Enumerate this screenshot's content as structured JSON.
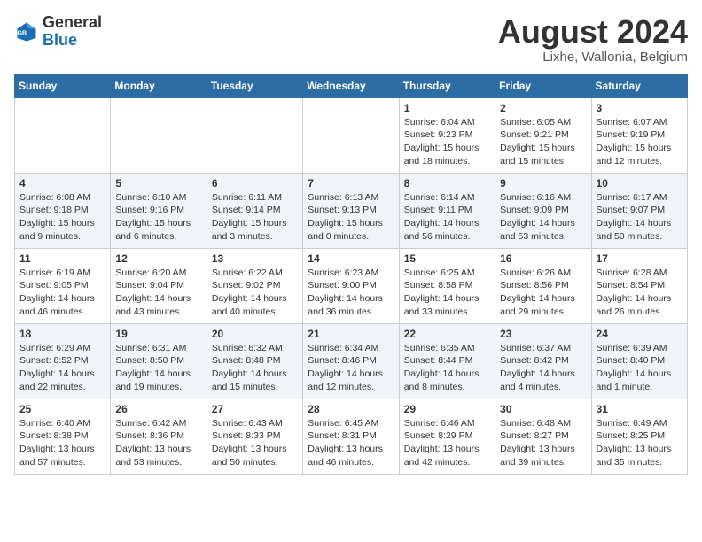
{
  "header": {
    "logo_general": "General",
    "logo_blue": "Blue",
    "month_title": "August 2024",
    "location": "Lixhe, Wallonia, Belgium"
  },
  "weekdays": [
    "Sunday",
    "Monday",
    "Tuesday",
    "Wednesday",
    "Thursday",
    "Friday",
    "Saturday"
  ],
  "weeks": [
    [
      {
        "day": "",
        "info": ""
      },
      {
        "day": "",
        "info": ""
      },
      {
        "day": "",
        "info": ""
      },
      {
        "day": "",
        "info": ""
      },
      {
        "day": "1",
        "info": "Sunrise: 6:04 AM\nSunset: 9:23 PM\nDaylight: 15 hours\nand 18 minutes."
      },
      {
        "day": "2",
        "info": "Sunrise: 6:05 AM\nSunset: 9:21 PM\nDaylight: 15 hours\nand 15 minutes."
      },
      {
        "day": "3",
        "info": "Sunrise: 6:07 AM\nSunset: 9:19 PM\nDaylight: 15 hours\nand 12 minutes."
      }
    ],
    [
      {
        "day": "4",
        "info": "Sunrise: 6:08 AM\nSunset: 9:18 PM\nDaylight: 15 hours\nand 9 minutes."
      },
      {
        "day": "5",
        "info": "Sunrise: 6:10 AM\nSunset: 9:16 PM\nDaylight: 15 hours\nand 6 minutes."
      },
      {
        "day": "6",
        "info": "Sunrise: 6:11 AM\nSunset: 9:14 PM\nDaylight: 15 hours\nand 3 minutes."
      },
      {
        "day": "7",
        "info": "Sunrise: 6:13 AM\nSunset: 9:13 PM\nDaylight: 15 hours\nand 0 minutes."
      },
      {
        "day": "8",
        "info": "Sunrise: 6:14 AM\nSunset: 9:11 PM\nDaylight: 14 hours\nand 56 minutes."
      },
      {
        "day": "9",
        "info": "Sunrise: 6:16 AM\nSunset: 9:09 PM\nDaylight: 14 hours\nand 53 minutes."
      },
      {
        "day": "10",
        "info": "Sunrise: 6:17 AM\nSunset: 9:07 PM\nDaylight: 14 hours\nand 50 minutes."
      }
    ],
    [
      {
        "day": "11",
        "info": "Sunrise: 6:19 AM\nSunset: 9:05 PM\nDaylight: 14 hours\nand 46 minutes."
      },
      {
        "day": "12",
        "info": "Sunrise: 6:20 AM\nSunset: 9:04 PM\nDaylight: 14 hours\nand 43 minutes."
      },
      {
        "day": "13",
        "info": "Sunrise: 6:22 AM\nSunset: 9:02 PM\nDaylight: 14 hours\nand 40 minutes."
      },
      {
        "day": "14",
        "info": "Sunrise: 6:23 AM\nSunset: 9:00 PM\nDaylight: 14 hours\nand 36 minutes."
      },
      {
        "day": "15",
        "info": "Sunrise: 6:25 AM\nSunset: 8:58 PM\nDaylight: 14 hours\nand 33 minutes."
      },
      {
        "day": "16",
        "info": "Sunrise: 6:26 AM\nSunset: 8:56 PM\nDaylight: 14 hours\nand 29 minutes."
      },
      {
        "day": "17",
        "info": "Sunrise: 6:28 AM\nSunset: 8:54 PM\nDaylight: 14 hours\nand 26 minutes."
      }
    ],
    [
      {
        "day": "18",
        "info": "Sunrise: 6:29 AM\nSunset: 8:52 PM\nDaylight: 14 hours\nand 22 minutes."
      },
      {
        "day": "19",
        "info": "Sunrise: 6:31 AM\nSunset: 8:50 PM\nDaylight: 14 hours\nand 19 minutes."
      },
      {
        "day": "20",
        "info": "Sunrise: 6:32 AM\nSunset: 8:48 PM\nDaylight: 14 hours\nand 15 minutes."
      },
      {
        "day": "21",
        "info": "Sunrise: 6:34 AM\nSunset: 8:46 PM\nDaylight: 14 hours\nand 12 minutes."
      },
      {
        "day": "22",
        "info": "Sunrise: 6:35 AM\nSunset: 8:44 PM\nDaylight: 14 hours\nand 8 minutes."
      },
      {
        "day": "23",
        "info": "Sunrise: 6:37 AM\nSunset: 8:42 PM\nDaylight: 14 hours\nand 4 minutes."
      },
      {
        "day": "24",
        "info": "Sunrise: 6:39 AM\nSunset: 8:40 PM\nDaylight: 14 hours\nand 1 minute."
      }
    ],
    [
      {
        "day": "25",
        "info": "Sunrise: 6:40 AM\nSunset: 8:38 PM\nDaylight: 13 hours\nand 57 minutes."
      },
      {
        "day": "26",
        "info": "Sunrise: 6:42 AM\nSunset: 8:36 PM\nDaylight: 13 hours\nand 53 minutes."
      },
      {
        "day": "27",
        "info": "Sunrise: 6:43 AM\nSunset: 8:33 PM\nDaylight: 13 hours\nand 50 minutes."
      },
      {
        "day": "28",
        "info": "Sunrise: 6:45 AM\nSunset: 8:31 PM\nDaylight: 13 hours\nand 46 minutes."
      },
      {
        "day": "29",
        "info": "Sunrise: 6:46 AM\nSunset: 8:29 PM\nDaylight: 13 hours\nand 42 minutes."
      },
      {
        "day": "30",
        "info": "Sunrise: 6:48 AM\nSunset: 8:27 PM\nDaylight: 13 hours\nand 39 minutes."
      },
      {
        "day": "31",
        "info": "Sunrise: 6:49 AM\nSunset: 8:25 PM\nDaylight: 13 hours\nand 35 minutes."
      }
    ]
  ]
}
